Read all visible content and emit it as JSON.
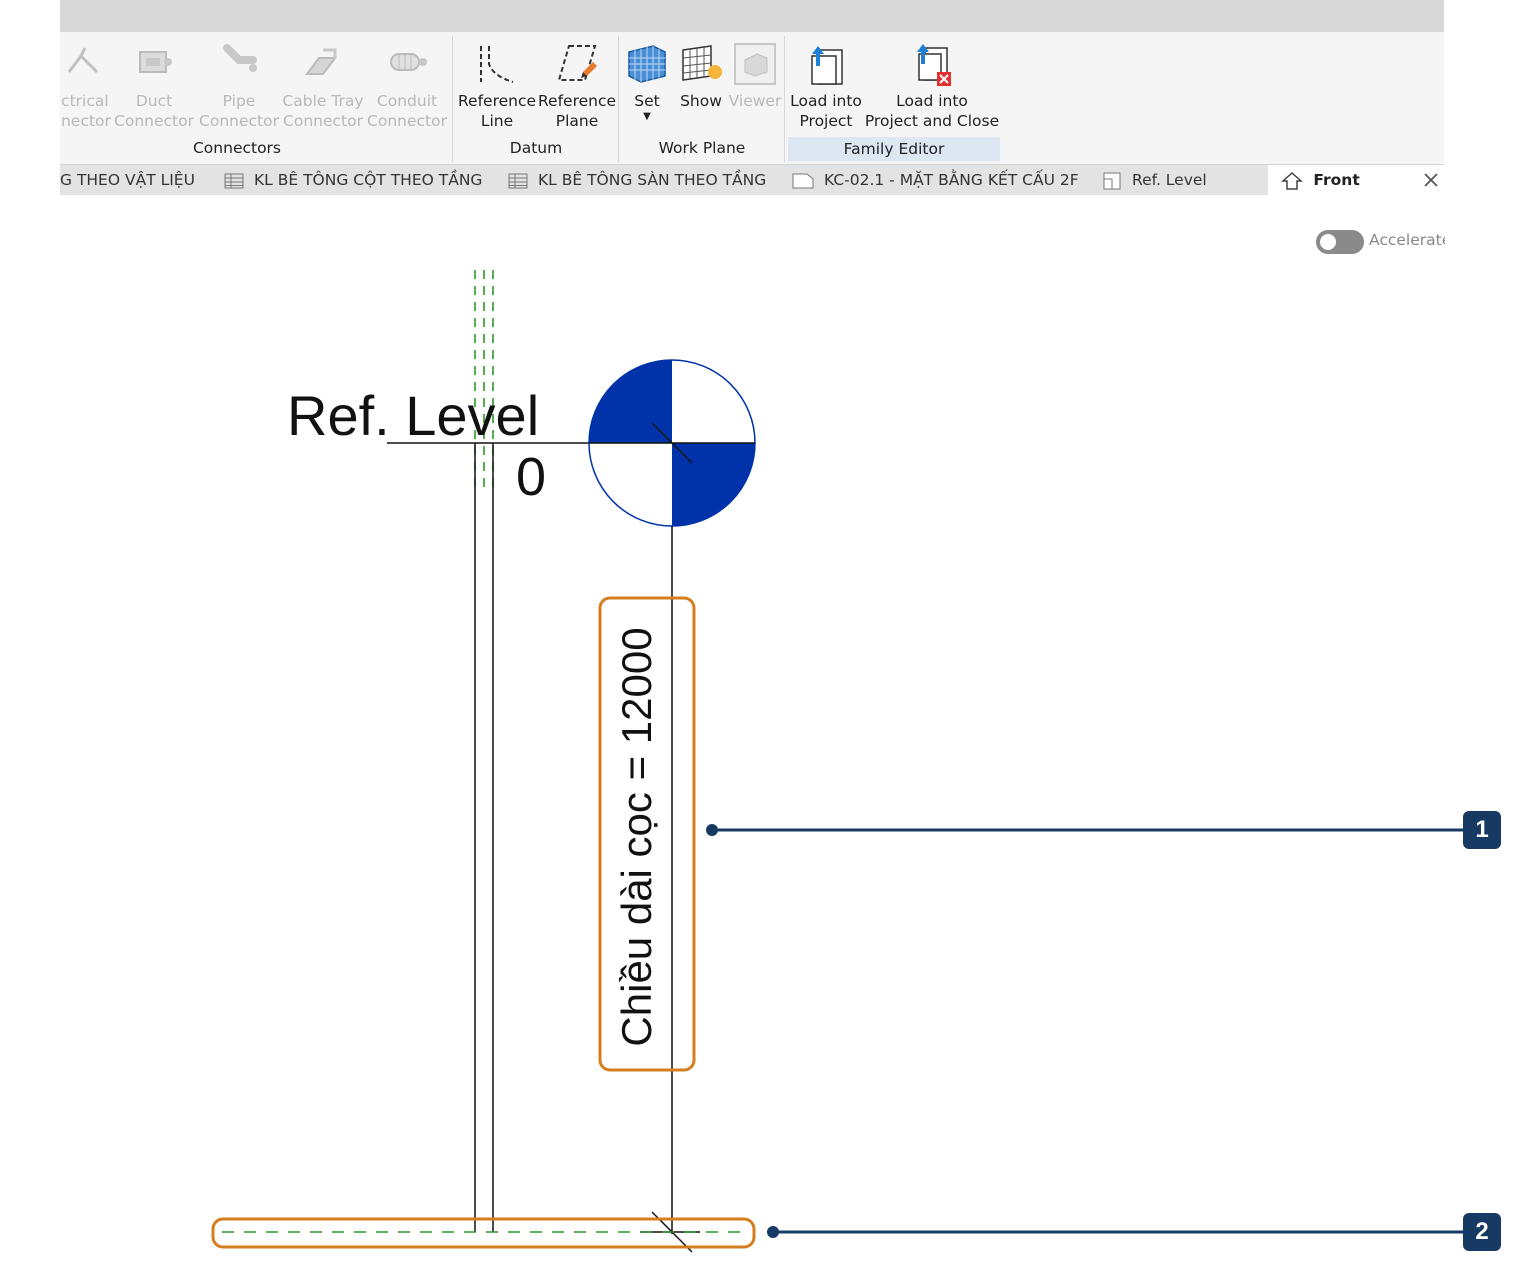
{
  "ribbon": {
    "tools": [
      {
        "id": "electrical-connector",
        "label": "ctrical\nnector",
        "icon": "electrical-connector-icon",
        "enabled": false
      },
      {
        "id": "duct-connector",
        "label": "Duct\nConnector",
        "icon": "duct-connector-icon",
        "enabled": false
      },
      {
        "id": "pipe-connector",
        "label": "Pipe\nConnector",
        "icon": "pipe-connector-icon",
        "enabled": false
      },
      {
        "id": "cable-tray-connector",
        "label": "Cable Tray\nConnector",
        "icon": "cable-tray-connector-icon",
        "enabled": false
      },
      {
        "id": "conduit-connector",
        "label": "Conduit\nConnector",
        "icon": "conduit-connector-icon",
        "enabled": false
      },
      {
        "id": "reference-line",
        "label": "Reference\nLine",
        "icon": "reference-line-icon",
        "enabled": true
      },
      {
        "id": "reference-plane",
        "label": "Reference\nPlane",
        "icon": "reference-plane-icon",
        "enabled": true
      },
      {
        "id": "set",
        "label": "Set",
        "icon": "set-workplane-icon",
        "enabled": true
      },
      {
        "id": "show",
        "label": "Show",
        "icon": "show-workplane-icon",
        "enabled": true
      },
      {
        "id": "viewer",
        "label": "Viewer",
        "icon": "viewer-icon",
        "enabled": false
      },
      {
        "id": "load-into-project",
        "label": "Load into\nProject",
        "icon": "load-into-project-icon",
        "enabled": true
      },
      {
        "id": "load-into-project-and-close",
        "label": "Load into\nProject and Close",
        "icon": "load-into-project-close-icon",
        "enabled": true
      }
    ],
    "panels": {
      "connectors": "Connectors",
      "datum": "Datum",
      "work_plane": "Work Plane",
      "family_editor": "Family Editor"
    }
  },
  "tabs": [
    {
      "label": "G THEO VẬT LIỆU",
      "icon": ""
    },
    {
      "label": "KL BÊ TÔNG CỘT THEO TẦNG",
      "icon": "schedule-icon"
    },
    {
      "label": "KL BÊ TÔNG SÀN THEO TẦNG",
      "icon": "schedule-icon"
    },
    {
      "label": "KC-02.1 - MẶT BẰNG KẾT CẤU 2F",
      "icon": "sheet-icon"
    },
    {
      "label": "Ref. Level",
      "icon": "floor-plan-icon"
    },
    {
      "label": "Front",
      "icon": "elevation-icon",
      "active": true
    }
  ],
  "toggle": {
    "label": "Accelerate",
    "on": false
  },
  "canvas": {
    "level_name": "Ref. Level",
    "level_value": "0",
    "dimension_label": "Chiều dài cọc = 12000"
  },
  "callouts": [
    "1",
    "2"
  ],
  "colors": {
    "level_head_blue": "#0033aa",
    "ref_plane_green": "#2a9a2a",
    "highlight_orange": "#d47e1f",
    "callout_navy": "#173a64",
    "family_editor_panel": "#dde6f3"
  }
}
